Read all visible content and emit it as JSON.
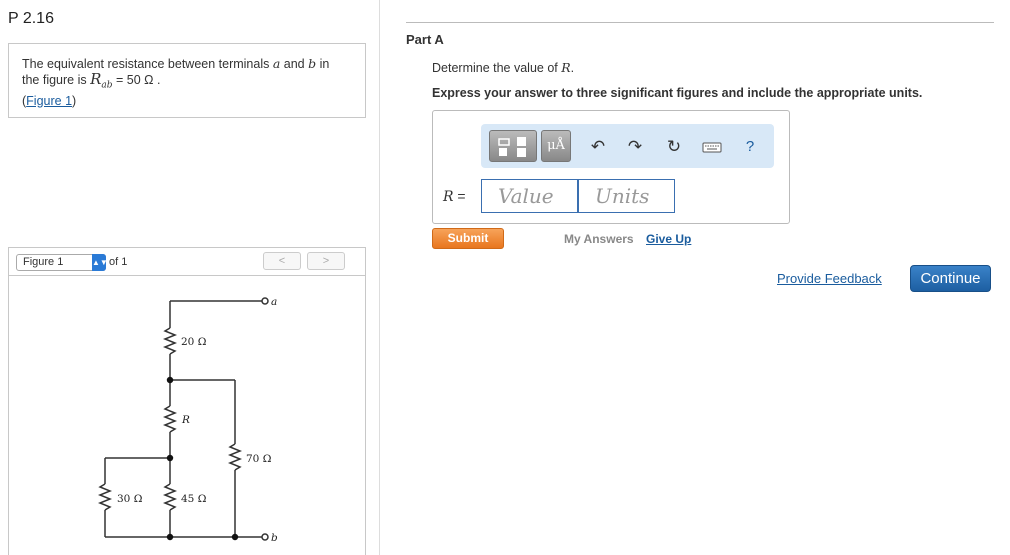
{
  "problem": {
    "title": "P 2.16",
    "statement_pre": "The equivalent resistance between terminals ",
    "var_a": "a",
    "statement_and": " and ",
    "var_b": "b",
    "statement_in": " in",
    "statement_line2_pre": "the figure is ",
    "rab_symbol": "R",
    "rab_subscript": "ab",
    "rab_value": " = 50 Ω .",
    "figure_link": "Figure 1",
    "link_open": "(",
    "link_close": ")"
  },
  "figure_nav": {
    "selected": "Figure 1",
    "of_text": "of 1",
    "prev": "<",
    "next": ">"
  },
  "circuit": {
    "labels": {
      "terminal_a": "a",
      "terminal_b": "b",
      "r20": "20 Ω",
      "r_unknown": "R",
      "r70": "70 Ω",
      "r30": "30 Ω",
      "r45": "45 Ω"
    }
  },
  "part": {
    "label": "Part A",
    "question_pre": "Determine the value of ",
    "question_var": "R",
    "question_post": ".",
    "instruction": "Express your answer to three significant figures and include the appropriate units."
  },
  "answer": {
    "units_button": "μÅ",
    "help": "?",
    "var_label": "R",
    "equals": " =",
    "value_placeholder": "Value",
    "units_placeholder": "Units"
  },
  "actions": {
    "submit": "Submit",
    "my_answers": "My Answers",
    "give_up": "Give Up",
    "feedback": "Provide Feedback",
    "continue": "Continue"
  },
  "colors": {
    "accent_blue": "#1a5c9e",
    "submit_orange": "#f0862c",
    "toolbar_bg": "#d8e8f7"
  }
}
